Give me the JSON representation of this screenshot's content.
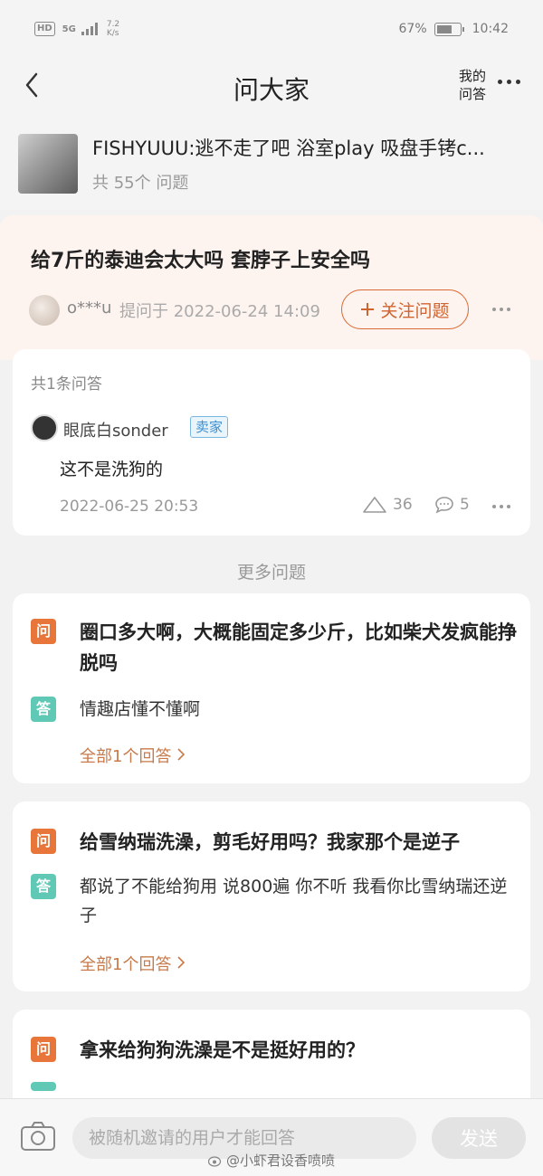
{
  "status_bar": {
    "hd": "HD",
    "net": "5G",
    "speed_value": "7.2",
    "speed_unit": "K/s",
    "battery": "67%",
    "battery_level": 0.67,
    "time": "10:42"
  },
  "nav": {
    "title": "问大家",
    "my_qa_line1": "我的",
    "my_qa_line2": "问答"
  },
  "product": {
    "title": "FISHYUUU:逃不走了吧 浴室play 吸盘手铐c...",
    "count": "共 55个 问题"
  },
  "question": {
    "title": "给7斤的泰迪会太大吗 套脖子上安全吗",
    "asker": "o***u",
    "asked_at": "提问于 2022-06-24 14:09",
    "follow_label": "关注问题"
  },
  "answers": {
    "count": "共1条问答",
    "user": "眼底白sonder",
    "seller_badge": "卖家",
    "text": "这不是洗狗的",
    "date": "2022-06-25 20:53",
    "likes": "36",
    "comments": "5"
  },
  "more": {
    "title": "更多问题",
    "q_tag": "问",
    "a_tag": "答",
    "items": [
      {
        "q": "圈口多大啊，大概能固定多少斤，比如柴犬发疯能挣脱吗",
        "a": "情趣店懂不懂啊",
        "all": "全部1个回答"
      },
      {
        "q": "给雪纳瑞洗澡，剪毛好用吗？我家那个是逆子",
        "a": "都说了不能给狗用 说800遍 你不听 我看你比雪纳瑞还逆子",
        "all": "全部1个回答"
      },
      {
        "q": "拿来给狗狗洗澡是不是挺好用的？"
      }
    ]
  },
  "bottom": {
    "placeholder": "被随机邀请的用户才能回答",
    "send": "发送"
  },
  "watermark": "@小虾君设香喷喷"
}
